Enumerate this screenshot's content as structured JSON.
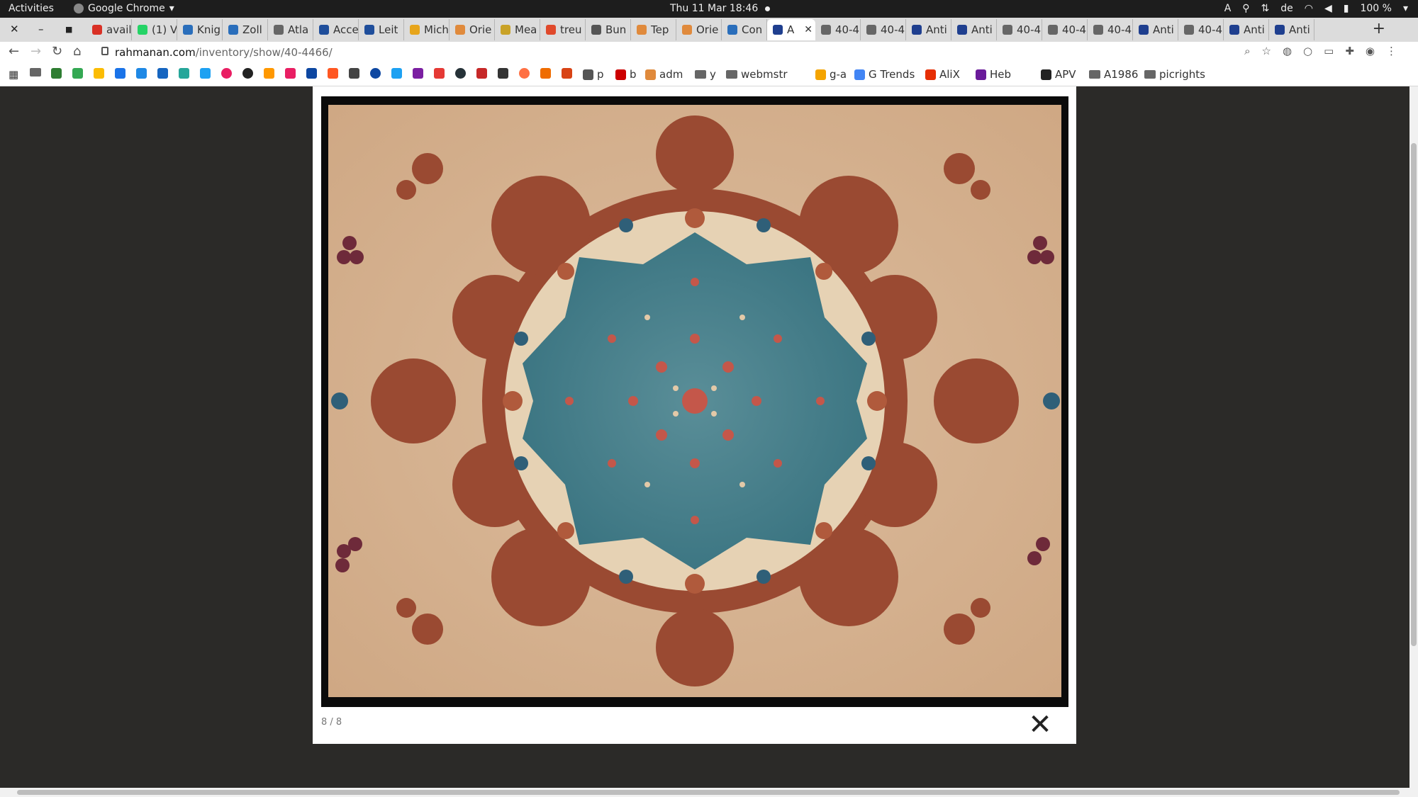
{
  "system_bar": {
    "activities": "Activities",
    "app_name": "Google Chrome",
    "clock": "Thu 11 Mar  18:46",
    "keyboard_layout": "de",
    "battery": "100 %"
  },
  "tabs": [
    {
      "label": "avail",
      "favicon_color": "#d93025"
    },
    {
      "label": "(1) V",
      "favicon_color": "#25d366"
    },
    {
      "label": "Knig",
      "favicon_color": "#2a6ebb"
    },
    {
      "label": "Zoll",
      "favicon_color": "#2a6ebb"
    },
    {
      "label": "Atla",
      "favicon_color": "#666666"
    },
    {
      "label": "Acce",
      "favicon_color": "#1f4e9b"
    },
    {
      "label": "Leit",
      "favicon_color": "#1f4e9b"
    },
    {
      "label": "Mich",
      "favicon_color": "#e7a51b"
    },
    {
      "label": "Orie",
      "favicon_color": "#e08a3c"
    },
    {
      "label": "Mea",
      "favicon_color": "#c9a227"
    },
    {
      "label": "treu",
      "favicon_color": "#e0492b"
    },
    {
      "label": "Bun",
      "favicon_color": "#555555"
    },
    {
      "label": "Tep",
      "favicon_color": "#e08a3c"
    },
    {
      "label": "Orie",
      "favicon_color": "#e08a3c"
    },
    {
      "label": "Con",
      "favicon_color": "#2a6ebb"
    },
    {
      "label": "A",
      "favicon_color": "#1f3f8f",
      "active": true
    },
    {
      "label": "40-4",
      "favicon_color": "#666666"
    },
    {
      "label": "40-4",
      "favicon_color": "#666666"
    },
    {
      "label": "Anti",
      "favicon_color": "#1f3f8f"
    },
    {
      "label": "Anti",
      "favicon_color": "#1f3f8f"
    },
    {
      "label": "40-4",
      "favicon_color": "#666666"
    },
    {
      "label": "40-4",
      "favicon_color": "#666666"
    },
    {
      "label": "40-4",
      "favicon_color": "#666666"
    },
    {
      "label": "Anti",
      "favicon_color": "#1f3f8f"
    },
    {
      "label": "40-4",
      "favicon_color": "#666666"
    },
    {
      "label": "Anti",
      "favicon_color": "#1f3f8f"
    },
    {
      "label": "Anti",
      "favicon_color": "#1f3f8f"
    }
  ],
  "address_bar": {
    "host": "rahmanan.com",
    "path": "/inventory/show/40-4466/"
  },
  "bookmarks": {
    "items": [
      {
        "label": "p",
        "color": "#555555"
      },
      {
        "label": "b",
        "color": "#cc0000"
      },
      {
        "label": "adm",
        "color": "#e08a3c"
      },
      {
        "label": "y",
        "folder": true
      },
      {
        "label": "webmstr",
        "folder": true
      },
      {
        "label": "g-a",
        "color": "#f4a400"
      },
      {
        "label": "G Trends",
        "color": "#4285f4"
      },
      {
        "label": "AliX",
        "color": "#e62e04"
      },
      {
        "label": "Heb",
        "color": "#6a1b9a"
      },
      {
        "label": "APV",
        "color": "#222222"
      },
      {
        "label": "A1986",
        "folder": true
      },
      {
        "label": "picrights",
        "folder": true
      }
    ]
  },
  "lightbox": {
    "counter": "8 / 8",
    "close_glyph": "✕",
    "image_subject": "persian-rug-medallion"
  },
  "colors": {
    "page_bg": "#2b2a28",
    "rug_field": "#d8b594",
    "rug_medallion": "#3f7f8c",
    "rug_border": "#9a4a32"
  }
}
